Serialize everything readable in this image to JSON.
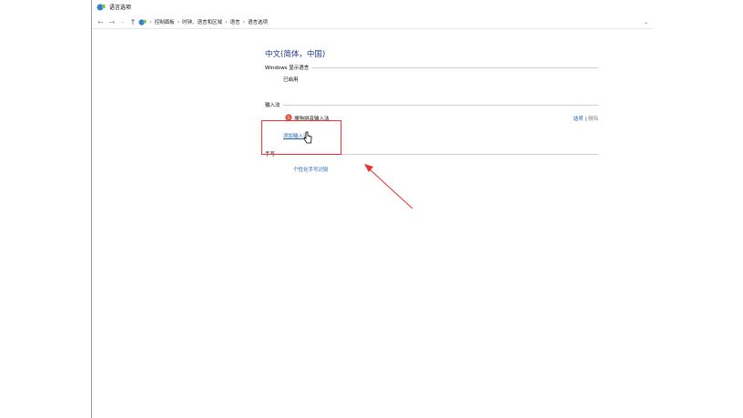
{
  "window": {
    "title": "语言选项"
  },
  "address": {
    "crumbs": [
      "控制面板",
      "时钟、语言和区域",
      "语言",
      "语言选项"
    ]
  },
  "language": {
    "name": "中文(简体，中国)",
    "display_section": "Windows 显示语言",
    "display_status": "已启用"
  },
  "ime": {
    "section": "输入法",
    "item_name": "搜狗拼音输入法",
    "options": "选项",
    "separator": "|",
    "remove": "删除",
    "add_link": "添加输入法"
  },
  "handwriting": {
    "section": "手写",
    "personalize_link": "个性化手写识别"
  },
  "colors": {
    "link": "#1a5fb4",
    "heading": "#1e3a8a",
    "annotation": "#e33333"
  }
}
